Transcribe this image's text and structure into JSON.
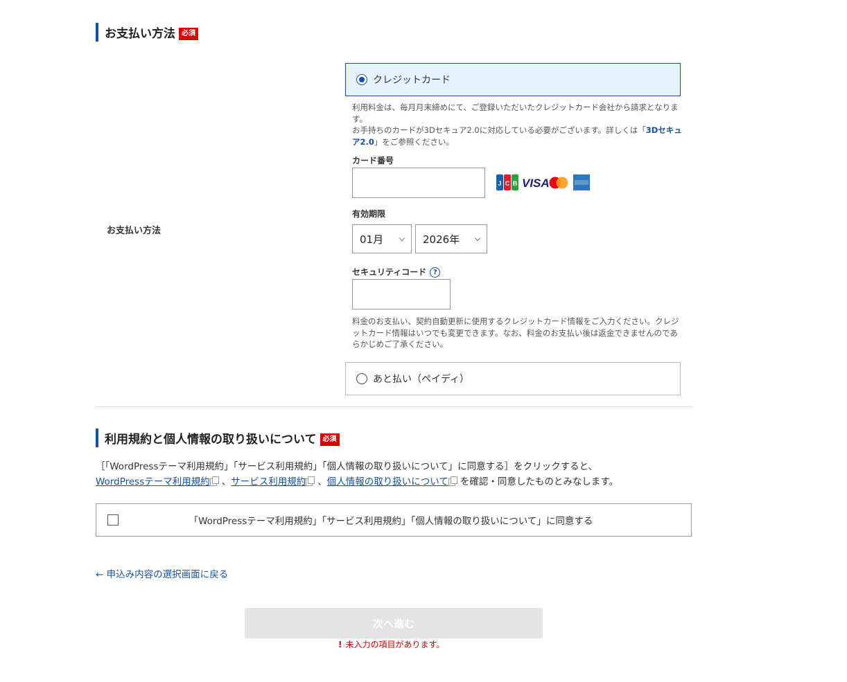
{
  "payment_section": {
    "title": "お支払い方法",
    "required_badge": "必須",
    "row_label": "お支払い方法",
    "options": {
      "credit": {
        "label": "クレジットカード",
        "selected": true
      },
      "deferred": {
        "label": "あと払い（ペイディ）",
        "selected": false
      }
    },
    "credit_notes": {
      "line1": "利用料金は、毎月月末締めにて、ご登録いただいたクレジットカード会社から請求となります。",
      "line2_prefix": "お手持ちのカードが3Dセキュア2.0に対応している必要がございます。詳しくは「",
      "link_3ds": "3Dセキュア2.0",
      "line2_suffix": "」をご参照ください。"
    },
    "card_number": {
      "label": "カード番号",
      "value": ""
    },
    "card_brands": [
      "JCB",
      "VISA",
      "Mastercard",
      "AMERICAN EXPRESS"
    ],
    "expiry": {
      "label": "有効期限",
      "month": "01月",
      "year": "2026年"
    },
    "security_code": {
      "label": "セキュリティコード",
      "help_icon": "question-circle-icon",
      "help_glyph": "?",
      "value": ""
    },
    "card_usage_note": "料金のお支払い、契約自動更新に使用するクレジットカード情報をご入力ください。クレジットカード情報はいつでも変更できます。なお、料金のお支払い後は返金できませんのであらかじめご了承ください。"
  },
  "terms_section": {
    "title": "利用規約と個人情報の取り扱いについて",
    "required_badge": "必須",
    "line1": "［「WordPressテーマ利用規約」「サービス利用規約」「個人情報の取り扱いについて」に同意する］をクリックすると、",
    "links": {
      "wp_terms": "WordPressテーマ利用規約",
      "service_terms": "サービス利用規約",
      "privacy": "個人情報の取り扱いについて"
    },
    "separator": "、",
    "line2_suffix": "を確認・同意したものとみなします。",
    "agree_label": "「WordPressテーマ利用規約」「サービス利用規約」「個人情報の取り扱いについて」に同意する",
    "agree_checked": false
  },
  "navigation": {
    "back_link": "← 申込み内容の選択画面に戻る",
    "next_button": "次へ進む",
    "error_icon": "!",
    "error_message": "未入力の項目があります。"
  },
  "colors": {
    "accent": "#1a4f9c",
    "required": "#d40000",
    "selected_bg": "#e6f3fd",
    "error": "#cc0000"
  }
}
